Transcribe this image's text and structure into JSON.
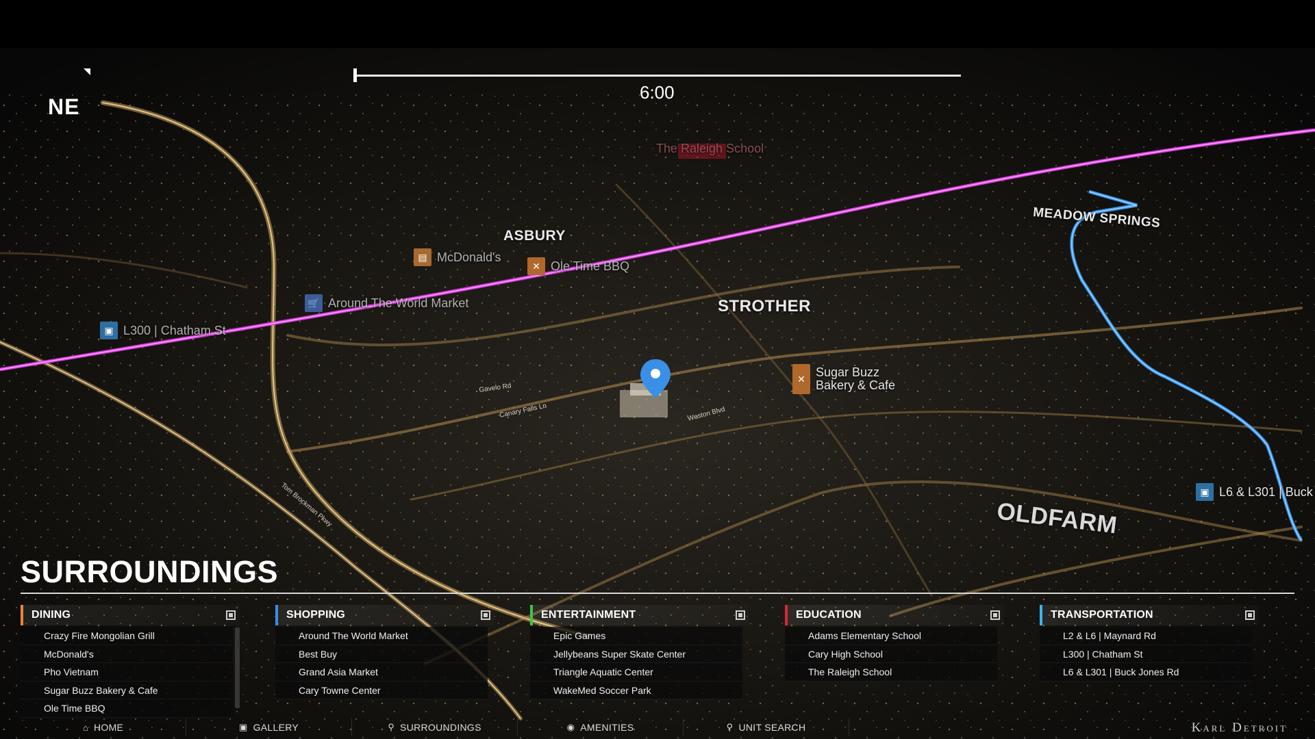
{
  "compass": {
    "heading": "NE"
  },
  "timeline": {
    "time": "6:00"
  },
  "map": {
    "area_labels": [
      "ASBURY",
      "STROTHER",
      "MEADOW SPRINGS",
      "OLDFARM"
    ],
    "street_labels": [
      "Gavelo Rd",
      "Canary Falls Ln",
      "Weston Blvd",
      "Tom Brockman Pkwy"
    ],
    "pois": {
      "raleigh_school": {
        "label": "The Raleigh School",
        "icon": "school-icon"
      },
      "mcdonalds": {
        "label": "McDonald's",
        "icon": "dining-icon"
      },
      "ole_time_bbq": {
        "label": "Ole Time BBQ",
        "icon": "utensils-icon"
      },
      "around_the_world": {
        "label": "Around The World Market",
        "icon": "cart-icon"
      },
      "l300": {
        "label": "L300 | Chatham St",
        "icon": "bus-icon"
      },
      "sugar_buzz": {
        "label_line1": "Sugar Buzz",
        "label_line2": "Bakery & Cafe",
        "icon": "utensils-icon"
      },
      "l6": {
        "label": "L6 & L301 | Buck",
        "icon": "bus-icon"
      }
    },
    "colors": {
      "route_magenta": "#e040e8",
      "route_blue": "#3aa0ff",
      "pin": "#3a8fe6"
    }
  },
  "panel": {
    "title": "SURROUNDINGS",
    "categories": [
      {
        "label": "DINING",
        "color": "#e8843a",
        "items": [
          "Crazy Fire Mongolian Grill",
          "McDonald's",
          "Pho Vietnam",
          "Sugar Buzz Bakery & Cafe",
          "Ole Time BBQ"
        ]
      },
      {
        "label": "SHOPPING",
        "color": "#3a8ee8",
        "items": [
          "Around The World Market",
          "Best Buy",
          "Grand Asia Market",
          "Cary Towne Center"
        ]
      },
      {
        "label": "ENTERTAINMENT",
        "color": "#3ec24a",
        "items": [
          "Epic Games",
          "Jellybeans Super Skate Center",
          "Triangle Aquatic Center",
          "WakeMed Soccer Park"
        ]
      },
      {
        "label": "EDUCATION",
        "color": "#d6283a",
        "items": [
          "Adams Elementary School",
          "Cary High School",
          "The Raleigh School"
        ]
      },
      {
        "label": "TRANSPORTATION",
        "color": "#3ab6e8",
        "items": [
          "L2 & L6 | Maynard Rd",
          "L300 | Chatham St",
          "L6 & L301 | Buck Jones Rd"
        ]
      }
    ]
  },
  "nav": {
    "items": [
      {
        "label": "HOME",
        "icon": "home-icon"
      },
      {
        "label": "GALLERY",
        "icon": "image-icon"
      },
      {
        "label": "SURROUNDINGS",
        "icon": "location-pin-icon"
      },
      {
        "label": "AMENITIES",
        "icon": "amenities-icon"
      },
      {
        "label": "UNIT SEARCH",
        "icon": "search-icon"
      }
    ],
    "brand": "Karl Detroit"
  }
}
